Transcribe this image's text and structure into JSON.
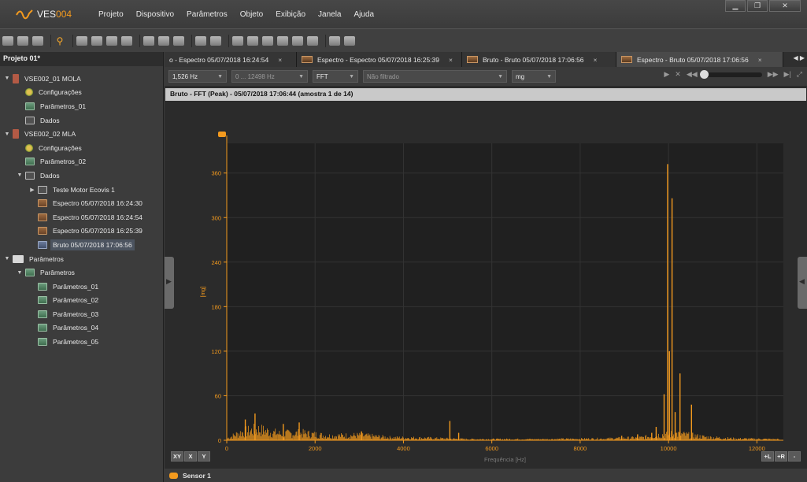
{
  "app": {
    "title_prefix": "VES",
    "title_num": "004"
  },
  "menu": [
    "Projeto",
    "Dispositivo",
    "Parâmetros",
    "Objeto",
    "Exibição",
    "Janela",
    "Ajuda"
  ],
  "window_controls": [
    "▁",
    "❐",
    "✕"
  ],
  "project": {
    "header": "Projeto 01*",
    "tree": [
      {
        "label": "VSE002_01 MOLA",
        "icon": "device-icon",
        "level": 0,
        "arrow": "▼"
      },
      {
        "label": "Configurações",
        "icon": "gear-icon",
        "level": 1
      },
      {
        "label": "Parâmetros_01",
        "icon": "params-icon",
        "level": 1
      },
      {
        "label": "Dados",
        "icon": "data-icon",
        "level": 1
      },
      {
        "label": "VSE002_02 MLA",
        "icon": "device-icon",
        "level": 0,
        "arrow": "▼"
      },
      {
        "label": "Configurações",
        "icon": "gear-icon",
        "level": 1
      },
      {
        "label": "Parâmetros_02",
        "icon": "params-icon",
        "level": 1
      },
      {
        "label": "Dados",
        "icon": "data-icon",
        "level": 1,
        "arrow": "▼"
      },
      {
        "label": "Teste Motor Ecovis 1",
        "icon": "data-icon",
        "level": 2,
        "arrow": "▶"
      },
      {
        "label": "Espectro 05/07/2018 16:24:30",
        "icon": "spectrum-icon",
        "level": 2
      },
      {
        "label": "Espectro 05/07/2018 16:24:54",
        "icon": "spectrum-icon",
        "level": 2
      },
      {
        "label": "Espectro 05/07/2018 16:25:39",
        "icon": "spectrum-icon",
        "level": 2
      },
      {
        "label": "Bruto 05/07/2018 17:06:56",
        "icon": "raw-icon",
        "level": 2,
        "selected": true
      },
      {
        "label": "Parâmetros",
        "icon": "folder-icon",
        "level": 0,
        "arrow": "▼"
      },
      {
        "label": "Parâmetros",
        "icon": "params-icon",
        "level": 1,
        "arrow": "▼"
      },
      {
        "label": "Parâmetros_01",
        "icon": "params-icon",
        "level": 2
      },
      {
        "label": "Parâmetros_02",
        "icon": "params-icon",
        "level": 2
      },
      {
        "label": "Parâmetros_03",
        "icon": "params-icon",
        "level": 2
      },
      {
        "label": "Parâmetros_04",
        "icon": "params-icon",
        "level": 2
      },
      {
        "label": "Parâmetros_05",
        "icon": "params-icon",
        "level": 2
      }
    ]
  },
  "tabs": [
    {
      "label": "o - Espectro 05/07/2018 16:24:54",
      "thumb": false,
      "active": false
    },
    {
      "label": "Espectro - Espectro 05/07/2018 16:25:39",
      "thumb": true,
      "active": false
    },
    {
      "label": "Bruto - Bruto 05/07/2018 17:06:56",
      "thumb": true,
      "active": false
    },
    {
      "label": "Espectro - Bruto 05/07/2018 17:06:56",
      "thumb": true,
      "active": true
    }
  ],
  "tab_close": "×",
  "tab_nav": "◀ ▶",
  "options": {
    "resolution": "1,526 Hz",
    "range": "0 ... 12498 Hz",
    "mode": "FFT",
    "filter": "Não filtrado",
    "unit": "mg"
  },
  "player": {
    "play": "▶",
    "fit": "✕",
    "rewind": "◀◀",
    "forward": "▶▶",
    "end": "▶|",
    "expand": "⤢",
    "position": 0
  },
  "plot_title": "Bruto - FFT (Peak) - 05/07/2018 17:06:44 (amostra 1 de 14)",
  "axis_buttons": [
    "XY",
    "X",
    "Y"
  ],
  "axis_buttons_right": [
    "+L",
    "+R",
    "-"
  ],
  "legend": {
    "series": "Sensor 1",
    "color": "#f39a1e"
  },
  "chart_data": {
    "type": "line",
    "xlabel": "Frequência [Hz]",
    "ylabel": "[mg]",
    "xlim": [
      0,
      12600
    ],
    "ylim": [
      0,
      400
    ],
    "x_ticks": [
      0,
      2000,
      4000,
      6000,
      8000,
      10000,
      12000
    ],
    "y_ticks": [
      0,
      60,
      120,
      180,
      240,
      300,
      360
    ],
    "grid": true,
    "series": [
      {
        "name": "Sensor 1",
        "color": "#f39a1e",
        "peaks": [
          {
            "x": 9980,
            "y": 372
          },
          {
            "x": 10080,
            "y": 326
          },
          {
            "x": 10020,
            "y": 120
          },
          {
            "x": 10260,
            "y": 90
          },
          {
            "x": 9900,
            "y": 62
          },
          {
            "x": 10520,
            "y": 48
          },
          {
            "x": 10150,
            "y": 38
          },
          {
            "x": 9720,
            "y": 18
          },
          {
            "x": 5050,
            "y": 26
          },
          {
            "x": 5250,
            "y": 10
          },
          {
            "x": 640,
            "y": 36
          },
          {
            "x": 420,
            "y": 28
          },
          {
            "x": 1280,
            "y": 22
          },
          {
            "x": 1640,
            "y": 24
          },
          {
            "x": 3050,
            "y": 12
          },
          {
            "x": 9620,
            "y": 10
          },
          {
            "x": 9300,
            "y": 8
          },
          {
            "x": 8940,
            "y": 6
          }
        ],
        "noise_floor": [
          {
            "x": 0,
            "y": 3
          },
          {
            "x": 300,
            "y": 14
          },
          {
            "x": 700,
            "y": 20
          },
          {
            "x": 1200,
            "y": 12
          },
          {
            "x": 1700,
            "y": 13
          },
          {
            "x": 2300,
            "y": 8
          },
          {
            "x": 3000,
            "y": 9
          },
          {
            "x": 3700,
            "y": 5
          },
          {
            "x": 4500,
            "y": 4
          },
          {
            "x": 5500,
            "y": 2
          },
          {
            "x": 7000,
            "y": 2
          },
          {
            "x": 8600,
            "y": 3
          },
          {
            "x": 9400,
            "y": 5
          },
          {
            "x": 9800,
            "y": 10
          },
          {
            "x": 10200,
            "y": 12
          },
          {
            "x": 10800,
            "y": 6
          },
          {
            "x": 11500,
            "y": 3
          },
          {
            "x": 12500,
            "y": 2
          }
        ]
      }
    ]
  }
}
